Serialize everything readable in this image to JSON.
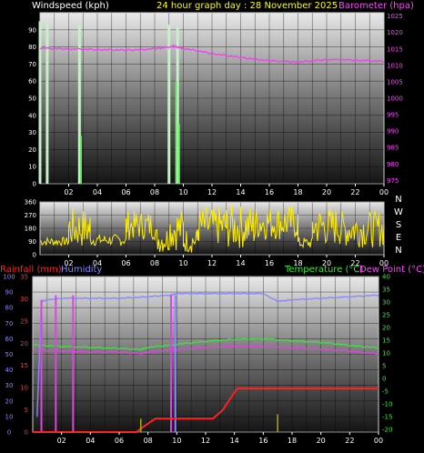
{
  "header": {
    "windspeed_label": "Windspeed (kph)",
    "title": "24 hour graph day : 28 November 2025",
    "barometer_label": "Barometer (hpa)"
  },
  "mid_labels": {
    "rainfall": "Rainfall (mm)",
    "humidity": "Humidity",
    "temperature": "Temperature (°C)",
    "dewpoint": "Dew Point (°C)"
  },
  "colors": {
    "wind": "#c8f0c8",
    "gust": "#66ee66",
    "barometer": "#ee44ee",
    "direction": "#ffee00",
    "rain": "#ff2222",
    "humidity": "#8888ff",
    "temperature": "#44dd44",
    "dewpoint": "#dd44dd",
    "rainrate": "#aaaa00",
    "label_yellow": "#ffff00",
    "label_magenta": "#ff44ff"
  },
  "chart_data": [
    {
      "type": "line",
      "name": "wind-barometer",
      "x_ticks": [
        "02",
        "04",
        "06",
        "08",
        "10",
        "12",
        "14",
        "16",
        "18",
        "20",
        "22",
        "00"
      ],
      "left_axis": {
        "label": "Windspeed (kph)",
        "ticks": [
          "0",
          "10",
          "20",
          "30",
          "40",
          "50",
          "60",
          "70",
          "80",
          "90"
        ],
        "range": [
          0,
          100
        ]
      },
      "right_axis": {
        "label": "Barometer (hpa)",
        "ticks": [
          "975",
          "980",
          "985",
          "990",
          "995",
          "1000",
          "1005",
          "1010",
          "1015",
          "1020",
          "1025"
        ],
        "range": [
          974,
          1026
        ]
      },
      "wind_spikes": [
        {
          "x": 0.0,
          "value": 95
        },
        {
          "x": 0.5,
          "value": 95
        },
        {
          "x": 2.75,
          "value": 93
        },
        {
          "x": 9.0,
          "value": 93
        },
        {
          "x": 9.6,
          "value": 92
        }
      ],
      "gust_spikes": [
        {
          "x": 2.85,
          "value": 28
        },
        {
          "x": 9.5,
          "value": 60
        },
        {
          "x": 9.7,
          "value": 35
        }
      ],
      "barometer": {
        "x": [
          0,
          2,
          4,
          6,
          8,
          9.3,
          10,
          12,
          14,
          16,
          18,
          20,
          22,
          24
        ],
        "y": [
          1015.2,
          1015.0,
          1014.8,
          1014.6,
          1015.0,
          1015.8,
          1015.2,
          1013.6,
          1012.4,
          1011.4,
          1011.0,
          1011.8,
          1011.6,
          1011.2
        ]
      }
    },
    {
      "type": "scatter",
      "name": "wind-direction",
      "x_ticks": [
        "02",
        "04",
        "06",
        "08",
        "10",
        "12",
        "14",
        "16",
        "18",
        "20",
        "22",
        "00"
      ],
      "left_axis": {
        "ticks": [
          "0",
          "90",
          "180",
          "270",
          "360"
        ],
        "range": [
          0,
          360
        ]
      },
      "right_axis": {
        "ticks": [
          "N",
          "W",
          "S",
          "E",
          "N"
        ]
      },
      "segments": [
        {
          "x": [
            0,
            2
          ],
          "low": 60,
          "high": 120
        },
        {
          "x": [
            2,
            3.5
          ],
          "low": 40,
          "high": 320
        },
        {
          "x": [
            3.5,
            6
          ],
          "low": 60,
          "high": 140
        },
        {
          "x": [
            6,
            8
          ],
          "low": 100,
          "high": 300
        },
        {
          "x": [
            8,
            9
          ],
          "low": 10,
          "high": 200
        },
        {
          "x": [
            9,
            10
          ],
          "low": 30,
          "high": 320
        },
        {
          "x": [
            10,
            11
          ],
          "low": 10,
          "high": 180
        },
        {
          "x": [
            11,
            13
          ],
          "low": 60,
          "high": 330
        },
        {
          "x": [
            13,
            15
          ],
          "low": 40,
          "high": 340
        },
        {
          "x": [
            15,
            18
          ],
          "low": 100,
          "high": 340
        },
        {
          "x": [
            18,
            19
          ],
          "low": 40,
          "high": 120
        },
        {
          "x": [
            19,
            21
          ],
          "low": 60,
          "high": 330
        },
        {
          "x": [
            21,
            24
          ],
          "low": 50,
          "high": 300
        }
      ]
    },
    {
      "type": "line",
      "name": "temperature-humidity-rain",
      "x_ticks": [
        "02",
        "04",
        "06",
        "08",
        "10",
        "12",
        "14",
        "16",
        "18",
        "20",
        "22",
        "00"
      ],
      "humidity_axis": {
        "label": "Humidity",
        "ticks": [
          "0",
          "10",
          "20",
          "30",
          "40",
          "50",
          "60",
          "70",
          "80",
          "90",
          "100"
        ],
        "range": [
          0,
          100
        ]
      },
      "rain_axis": {
        "label": "Rainfall (mm)",
        "ticks": [
          "0",
          "5",
          "10",
          "15",
          "20",
          "25",
          "30",
          "35"
        ],
        "range": [
          0,
          35
        ]
      },
      "temp_axis": {
        "label": "Temperature (°C)",
        "ticks": [
          "-20",
          "-15",
          "-10",
          "-5",
          "0",
          "5",
          "10",
          "15",
          "20",
          "25",
          "30",
          "35",
          "40"
        ],
        "range": [
          -21,
          40
        ]
      },
      "humidity": {
        "x": [
          0.3,
          0.6,
          1,
          2,
          4,
          6,
          8,
          9.5,
          10,
          12,
          14,
          16,
          17,
          18,
          20,
          22,
          24
        ],
        "y": [
          10,
          84,
          85,
          86,
          86,
          86,
          87,
          88,
          89,
          89,
          89,
          89,
          84,
          85,
          86,
          87,
          88
        ]
      },
      "temperature": {
        "x": [
          0,
          2,
          4,
          6,
          7.5,
          8,
          10,
          12,
          14,
          16,
          18,
          20,
          22,
          24
        ],
        "y": [
          13.2,
          12.6,
          12.2,
          11.8,
          11.4,
          12.2,
          13.4,
          14.6,
          15.4,
          15.6,
          14.8,
          14.2,
          13.0,
          12.0
        ]
      },
      "dewpoint": {
        "x": [
          0,
          2,
          4,
          6,
          7.5,
          8,
          10,
          12,
          14,
          16,
          18,
          20,
          22,
          24
        ],
        "y": [
          11.0,
          10.8,
          10.4,
          10.4,
          9.8,
          10.4,
          11.4,
          12.2,
          12.8,
          12.6,
          12.0,
          11.6,
          10.8,
          9.6
        ]
      },
      "rain": {
        "x": [
          0,
          7.2,
          7.6,
          8.5,
          12.5,
          13.2,
          13.8,
          14.2,
          24
        ],
        "y": [
          0,
          0,
          1,
          3,
          3,
          5,
          8,
          9.8,
          9.8
        ]
      },
      "rain_rate_marks": [
        {
          "x": 7.5,
          "value": 3
        },
        {
          "x": 17,
          "value": 4
        }
      ]
    }
  ]
}
